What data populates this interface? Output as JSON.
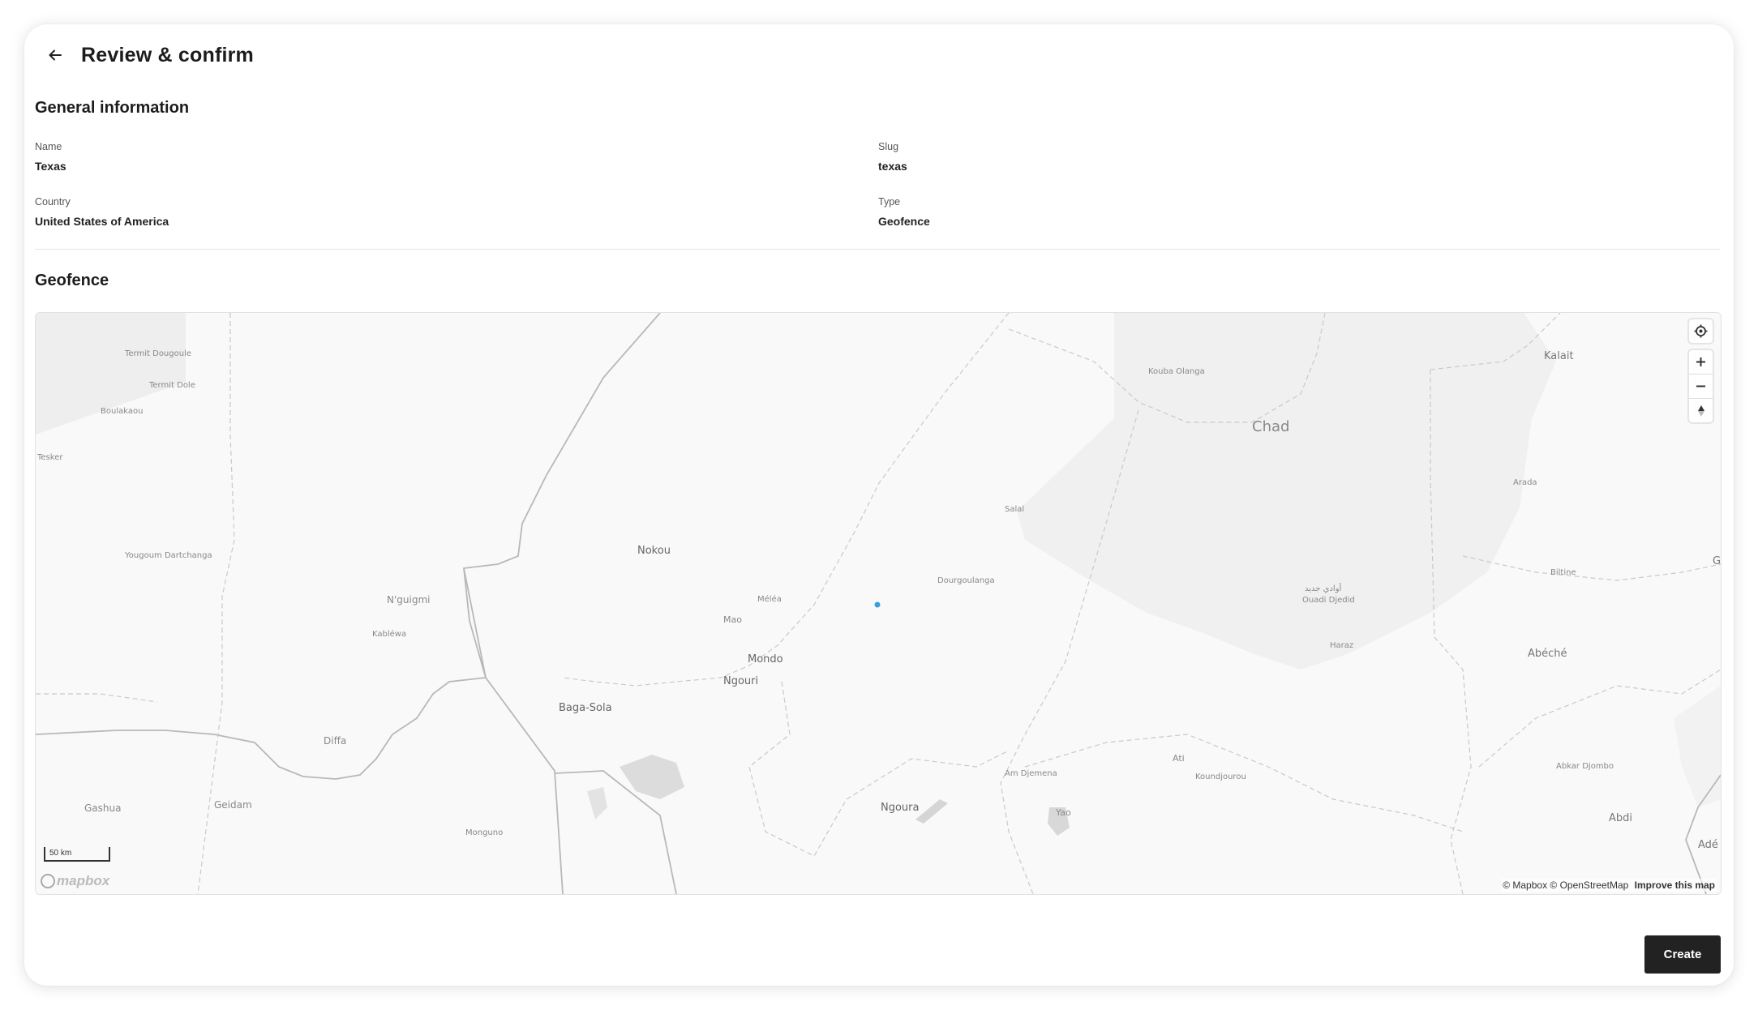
{
  "header": {
    "title": "Review & confirm"
  },
  "general": {
    "section_title": "General information",
    "fields": {
      "name": {
        "label": "Name",
        "value": "Texas"
      },
      "slug": {
        "label": "Slug",
        "value": "texas"
      },
      "country": {
        "label": "Country",
        "value": "United States of America"
      },
      "type": {
        "label": "Type",
        "value": "Geofence"
      }
    }
  },
  "geofence": {
    "section_title": "Geofence",
    "map": {
      "scale_label": "50 km",
      "logo_text": "mapbox",
      "attribution": "© Mapbox © OpenStreetMap",
      "improve_link": "Improve this map",
      "labels": {
        "chad": "Chad",
        "kalait": "Kalait",
        "kouba_olanga": "Kouba Olanga",
        "termit_dougoule": "Termit Dougoule",
        "termit_dole": "Termit Dole",
        "boulakaou": "Boulakaou",
        "tesker": "Tesker",
        "salal": "Salal",
        "arada": "Arada",
        "nokou": "Nokou",
        "yougoum": "Yougoum Dartchanga",
        "nguigmi": "N'guigmi",
        "melea": "Méléa",
        "mao": "Mao",
        "dourgoulanga": "Dourgoulanga",
        "ouadi_djedid": "Ouadi Djedid",
        "ouadi_arabic": "أوادي جديد",
        "biltine": "Biltine",
        "kablewa": "Kabléwa",
        "mondo": "Mondo",
        "ngouri": "Ngouri",
        "haraz": "Haraz",
        "abeche": "Abéché",
        "baga_sola": "Baga-Sola",
        "diffa": "Diffa",
        "ati": "Ati",
        "koundjourou": "Koundjourou",
        "abkar_djombo": "Abkar Djombo",
        "am_djemena": "Am Djemena",
        "gashua": "Gashua",
        "geidam": "Geidam",
        "ngoura": "Ngoura",
        "yao": "Yao",
        "abdi": "Abdi",
        "ade": "Adé",
        "monguno": "Monguno",
        "g": "G"
      }
    }
  },
  "actions": {
    "create_label": "Create"
  }
}
